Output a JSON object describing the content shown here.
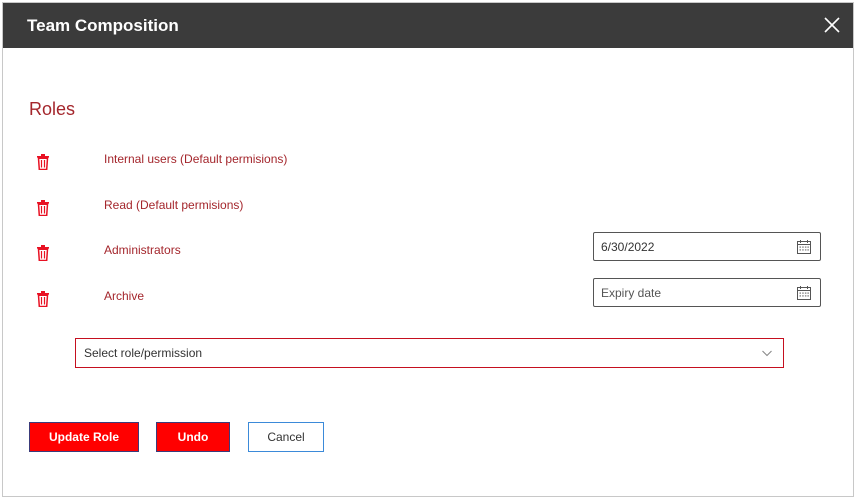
{
  "dialog": {
    "title": "Team Composition",
    "close_icon": "close-icon"
  },
  "section": {
    "title": "Roles"
  },
  "roles": [
    {
      "label": "Internal users (Default permisions)",
      "has_date": false
    },
    {
      "label": "Read (Default permisions)",
      "has_date": false
    },
    {
      "label": "Administrators",
      "has_date": true,
      "date_value": "6/30/2022"
    },
    {
      "label": "Archive",
      "has_date": true,
      "date_value": "",
      "date_placeholder": "Expiry date"
    }
  ],
  "select": {
    "placeholder": "Select role/permission"
  },
  "buttons": {
    "update": "Update Role",
    "undo": "Undo",
    "cancel": "Cancel"
  },
  "colors": {
    "header_bg": "#3b3b3b",
    "accent_red": "#a4262c",
    "trash_red": "#e81123",
    "primary_button": "#ff0000"
  }
}
